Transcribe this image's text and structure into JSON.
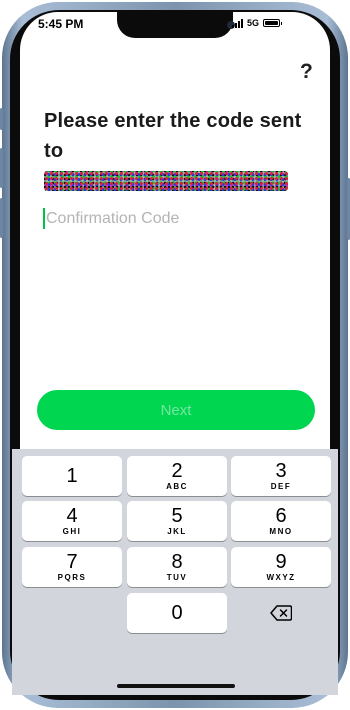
{
  "status_bar": {
    "time": "5:45 PM",
    "network": "5G"
  },
  "header": {
    "help_icon": "?",
    "title": "Please enter the code sent to"
  },
  "form": {
    "code_placeholder": "Confirmation Code",
    "code_value": "",
    "next_label": "Next"
  },
  "keypad": {
    "keys": [
      {
        "digit": "1",
        "letters": ""
      },
      {
        "digit": "2",
        "letters": "ABC"
      },
      {
        "digit": "3",
        "letters": "DEF"
      },
      {
        "digit": "4",
        "letters": "GHI"
      },
      {
        "digit": "5",
        "letters": "JKL"
      },
      {
        "digit": "6",
        "letters": "MNO"
      },
      {
        "digit": "7",
        "letters": "PQRS"
      },
      {
        "digit": "8",
        "letters": "TUV"
      },
      {
        "digit": "9",
        "letters": "WXYZ"
      },
      {
        "digit": "0",
        "letters": ""
      }
    ],
    "backspace_icon": "backspace-icon"
  },
  "colors": {
    "accent": "#00d64f",
    "accent_text": "#74e6a1",
    "caret": "#00c244",
    "keypad_bg": "#d2d5db"
  }
}
